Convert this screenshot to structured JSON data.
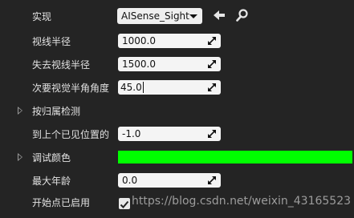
{
  "implement": {
    "label": "实现",
    "value": "AISense_Sight"
  },
  "properties": [
    {
      "label": "视线半径",
      "value": "1000.0"
    },
    {
      "label": "失去视线半径",
      "value": "1500.0"
    },
    {
      "label": "次要视觉半角角度",
      "value": "45.0"
    }
  ],
  "category_detect": {
    "label": "按归属检测"
  },
  "last_seen": {
    "label": "到上个已见位置的",
    "value": "-1.0"
  },
  "debug_color": {
    "label": "调试颜色",
    "color": "#00ff00"
  },
  "max_age": {
    "label": "最大年龄",
    "value": "0.0"
  },
  "start_enabled": {
    "label": "开始点已启用",
    "checked": true
  },
  "watermark": "https://blog.csdn.net/weixin_43165523",
  "colors": {
    "background": "#242424",
    "field": "#f4f4f4",
    "swatch": "#00ff00"
  }
}
